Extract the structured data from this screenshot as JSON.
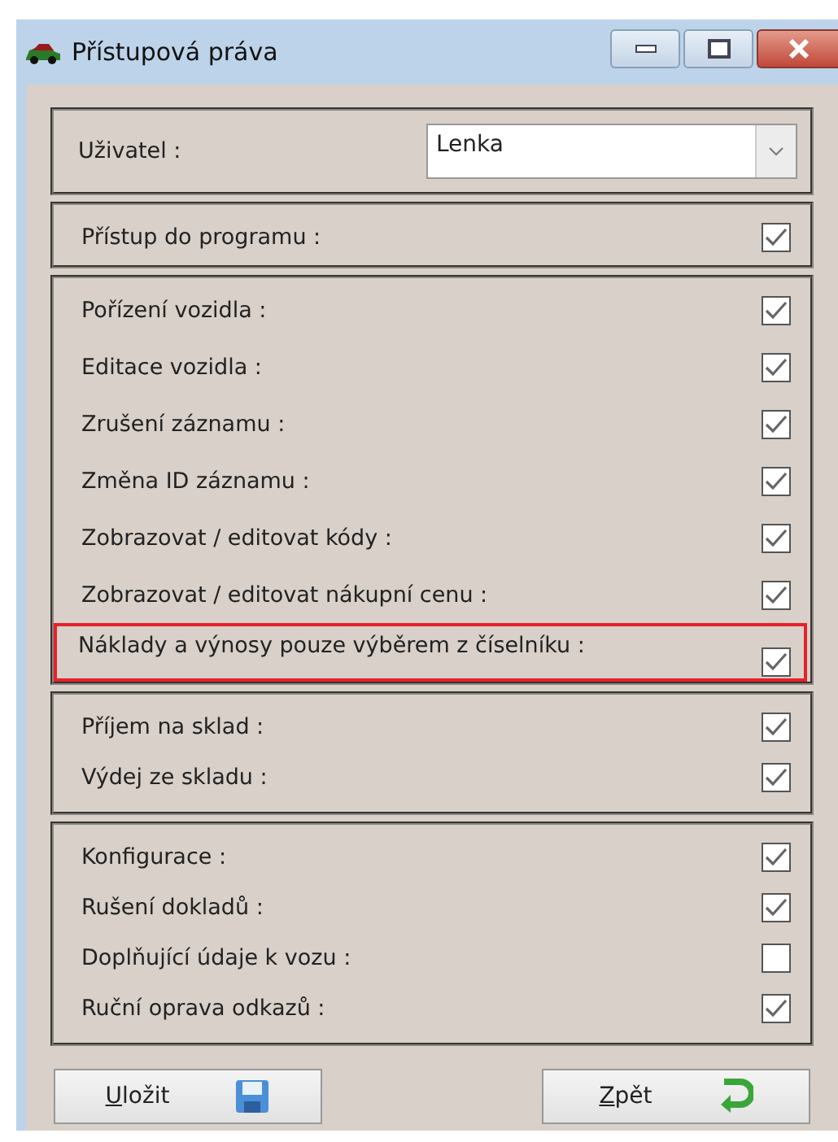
{
  "window": {
    "title": "Přístupová práva"
  },
  "user": {
    "label": "Uživatel :",
    "value": "Lenka"
  },
  "groups": [
    {
      "rows": [
        {
          "label": "Přístup do programu :",
          "checked": true,
          "highlighted": false
        }
      ],
      "kind": "wide"
    },
    {
      "rows": [
        {
          "label": "Pořízení vozidla :",
          "checked": true,
          "highlighted": false
        },
        {
          "label": "Editace vozidla :",
          "checked": true,
          "highlighted": false
        },
        {
          "label": "Zrušení záznamu :",
          "checked": true,
          "highlighted": false
        },
        {
          "label": "Změna ID záznamu :",
          "checked": true,
          "highlighted": false
        },
        {
          "label": "Zobrazovat / editovat kódy :",
          "checked": true,
          "highlighted": false
        },
        {
          "label": "Zobrazovat / editovat nákupní cenu :",
          "checked": true,
          "highlighted": false
        },
        {
          "label": "Náklady a výnosy pouze výběrem z číselníku :",
          "checked": true,
          "highlighted": true
        }
      ],
      "kind": "wide"
    },
    {
      "rows": [
        {
          "label": "Příjem na sklad :",
          "checked": true,
          "highlighted": false
        },
        {
          "label": "Výdej ze skladu :",
          "checked": true,
          "highlighted": false
        }
      ],
      "kind": "tight"
    },
    {
      "rows": [
        {
          "label": "Konfigurace :",
          "checked": true,
          "highlighted": false
        },
        {
          "label": "Rušení dokladů :",
          "checked": true,
          "highlighted": false
        },
        {
          "label": "Doplňující údaje k vozu :",
          "checked": false,
          "highlighted": false
        },
        {
          "label": "Ruční oprava odkazů :",
          "checked": true,
          "highlighted": false
        }
      ],
      "kind": "tight"
    }
  ],
  "buttons": [
    {
      "label": "Uložit",
      "kind": "save"
    },
    {
      "label": "Zpět",
      "kind": "back"
    }
  ]
}
